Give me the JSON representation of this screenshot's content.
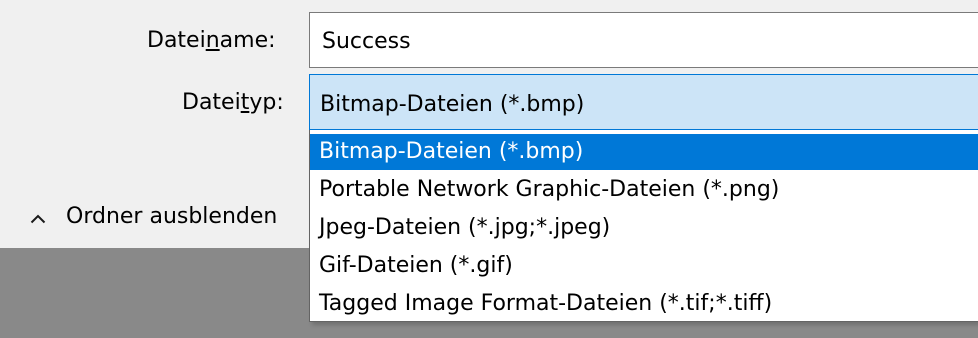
{
  "form": {
    "filename": {
      "label_prefix": "Datei",
      "label_mnemonic": "n",
      "label_suffix": "ame:",
      "value": "Success"
    },
    "filetype": {
      "label_prefix": "Datei",
      "label_mnemonic": "t",
      "label_suffix": "yp:",
      "selected_value": "Bitmap-Dateien (*.bmp)"
    }
  },
  "dropdown": {
    "options": [
      {
        "label": "Bitmap-Dateien (*.bmp)",
        "selected": true
      },
      {
        "label": "Portable Network Graphic-Dateien (*.png)",
        "selected": false
      },
      {
        "label": "Jpeg-Dateien (*.jpg;*.jpeg)",
        "selected": false
      },
      {
        "label": "Gif-Dateien (*.gif)",
        "selected": false
      },
      {
        "label": "Tagged Image Format-Dateien (*.tif;*.tiff)",
        "selected": false
      }
    ]
  },
  "folder_toggle": {
    "label": "Ordner ausblenden",
    "icon": "chevron-up-icon"
  },
  "colors": {
    "panel_bg": "#f0f0f0",
    "footer_bg": "#898989",
    "select_highlight": "#cce4f7",
    "accent": "#0078d7",
    "selected_text": "#ffffff"
  }
}
